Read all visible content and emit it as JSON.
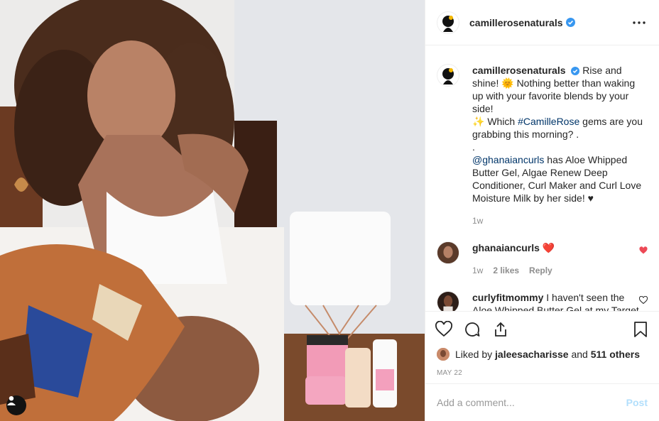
{
  "account": {
    "username": "camillerosenaturals",
    "verified": true,
    "more_icon": "more-horizontal-icon"
  },
  "caption": {
    "username": "camillerosenaturals",
    "line1": "Rise and shine!",
    "line2": "🌞 Nothing better than waking up with your favorite blends by your side!",
    "line3a": "✨ Which ",
    "hashtag": "#CamilleRose",
    "line3b": " gems are you grabbing this morning? .",
    "dot": ".",
    "mention": "@ghanaiancurls",
    "line4": " has Aloe Whipped Butter Gel, Algae Renew Deep Conditioner, Curl Maker and Curl Love Moisture Milk by her side! ♥",
    "time": "1w"
  },
  "comments": [
    {
      "username": "ghanaiancurls",
      "text": "",
      "emoji": "❤️",
      "time": "1w",
      "likes": "2 likes",
      "reply": "Reply",
      "liked": true
    },
    {
      "username": "curlyfitmommy",
      "text": "I haven't seen the Aloe Whipped Butter Gel at my Target in months!😒",
      "liked": false
    }
  ],
  "actions": {
    "like_icon": "heart-icon",
    "comment_icon": "comment-icon",
    "share_icon": "share-icon",
    "save_icon": "bookmark-icon"
  },
  "likes": {
    "prefix": "Liked by ",
    "user": "jaleesacharisse",
    "middle": " and ",
    "others": "511 others"
  },
  "date": "MAY 22",
  "add_comment": {
    "placeholder": "Add a comment...",
    "post_label": "Post"
  },
  "colors": {
    "link": "#003569",
    "heart_red": "#ed4956",
    "post_disabled": "#b2dffc",
    "verified_blue": "#3897f0"
  }
}
